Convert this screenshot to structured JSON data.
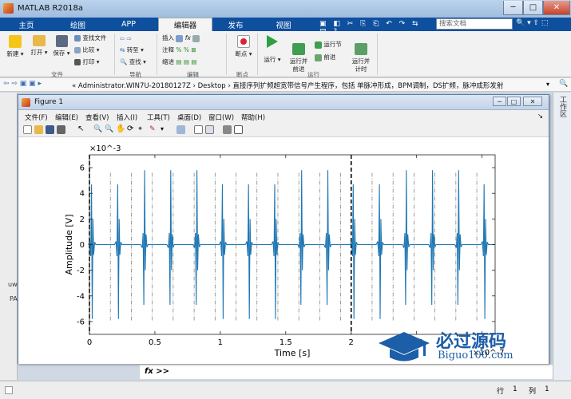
{
  "window": {
    "title": "MATLAB R2018a",
    "minimize": "─",
    "maximize": "□",
    "close": "✕"
  },
  "ribbon_tabs": [
    "主页",
    "绘图",
    "APP",
    "编辑器",
    "发布",
    "视图"
  ],
  "search_placeholder": "搜索文档",
  "ribbon": {
    "groups": {
      "file": "文件",
      "navigate": "导航",
      "edit": "编辑",
      "breakpoints": "断点",
      "run": "运行"
    },
    "new": "新建",
    "open": "打开",
    "save": "保存",
    "find_files": "查找文件",
    "compare": "比较",
    "print": "打印",
    "goto": "转至",
    "find": "查找",
    "insert": "插入",
    "comment": "注释",
    "indent": "缩进",
    "breakpoints": "断点",
    "run": "运行",
    "run_advance": "运行并\n前进",
    "run_section": "运行节",
    "advance": "前进",
    "run_time": "运行并\n计时",
    "fx": "fx"
  },
  "address": {
    "path": "«  Administrator.WIN7U-20180127Z  ›  Desktop  ›  直接序列扩频超宽带信号产生程序，包括 单脉冲形成，BPM调制，DS扩频，脉冲成形发射"
  },
  "figure": {
    "title": "Figure 1",
    "menu": [
      "文件(F)",
      "编辑(E)",
      "查看(V)",
      "插入(I)",
      "工具(T)",
      "桌面(D)",
      "窗口(W)",
      "帮助(H)"
    ]
  },
  "right_panel": "工作区",
  "left_panel": {
    "uw": "uw",
    "pa": "PA"
  },
  "cmd": {
    "prompt": "fx >>"
  },
  "status": {
    "row_label": "行",
    "row": "1",
    "col_label": "列",
    "col": "1"
  },
  "watermark": {
    "text": "必过源码",
    "url": "Biguo100.com"
  },
  "chart_data": {
    "type": "line",
    "xlabel": "Time [s]",
    "ylabel": "Amplitude [V]",
    "x_multiplier": "×10^-7",
    "y_multiplier": "×10^-3",
    "xlim": [
      0,
      3.1
    ],
    "ylim": [
      -7,
      7
    ],
    "xticks": [
      0,
      0.5,
      1,
      1.5,
      2,
      2.5,
      3
    ],
    "yticks": [
      -6,
      -4,
      -2,
      0,
      2,
      4,
      6
    ],
    "xtick_labels": [
      "0",
      "0.5",
      "1",
      "1.5",
      "2",
      "2.5",
      "3"
    ],
    "ytick_labels": [
      "-6",
      "-4",
      "-2",
      "0",
      "2",
      "4",
      "6"
    ],
    "frame_markers": [
      0,
      2
    ],
    "chip_markers": [
      0.16,
      0.32,
      0.48,
      0.64,
      0.8,
      0.96,
      1.12,
      1.28,
      1.44,
      1.6,
      1.76,
      1.92,
      2.16,
      2.32,
      2.48,
      2.64,
      2.8,
      2.96
    ],
    "pulses": [
      {
        "t": 0.02,
        "polarity": 1
      },
      {
        "t": 0.22,
        "polarity": 1
      },
      {
        "t": 0.42,
        "polarity": -1
      },
      {
        "t": 0.62,
        "polarity": -1
      },
      {
        "t": 0.82,
        "polarity": -1
      },
      {
        "t": 1.02,
        "polarity": 1
      },
      {
        "t": 1.22,
        "polarity": 1
      },
      {
        "t": 1.42,
        "polarity": 1
      },
      {
        "t": 1.62,
        "polarity": -1
      },
      {
        "t": 1.82,
        "polarity": -1
      },
      {
        "t": 2.02,
        "polarity": 1
      },
      {
        "t": 2.22,
        "polarity": 1
      },
      {
        "t": 2.42,
        "polarity": -1
      },
      {
        "t": 2.62,
        "polarity": -1
      },
      {
        "t": 2.82,
        "polarity": -1
      },
      {
        "t": 3.02,
        "polarity": 1
      }
    ],
    "pulse_peak": 4.7,
    "pulse_trough": -5.8,
    "line_color": "#1f77b4"
  }
}
